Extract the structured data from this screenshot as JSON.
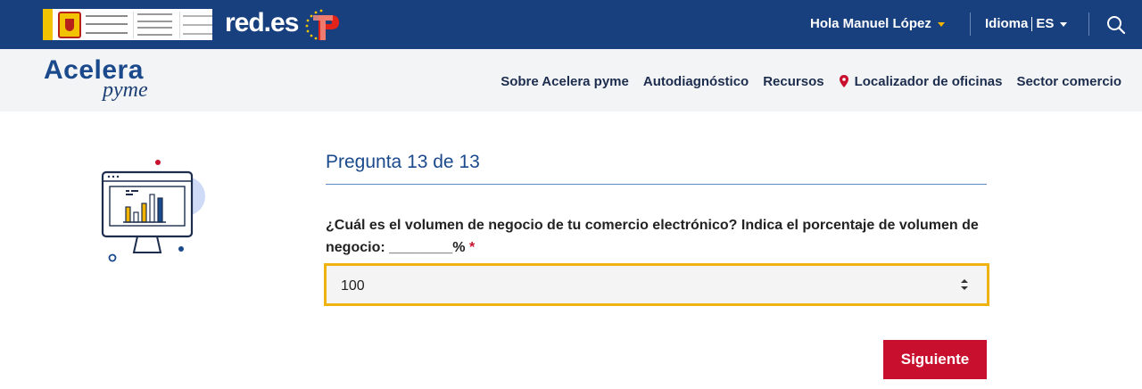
{
  "header": {
    "brand_redes": "red.es",
    "greeting": "Hola Manuel López",
    "language_label": "Idioma",
    "language_value": "ES"
  },
  "nav": {
    "brand_main": "Acelera",
    "brand_sub": "pyme",
    "links": [
      "Sobre Acelera pyme",
      "Autodiagnóstico",
      "Recursos",
      "Localizador de oficinas",
      "Sector comercio"
    ]
  },
  "question": {
    "counter": "Pregunta 13 de 13",
    "text": "¿Cuál es el volumen de negocio de tu comercio electrónico? Indica el porcentaje de volumen de negocio: ________%",
    "required_mark": "*",
    "selected_value": "100"
  },
  "actions": {
    "next_label": "Siguiente"
  },
  "colors": {
    "topbar": "#18407e",
    "brand_blue": "#1b4a8c",
    "accent_red": "#c8102e",
    "focus_gold": "#f0b20f"
  },
  "icons": [
    "spain-government-logo",
    "prtr-logo-icon",
    "search-icon",
    "location-pin-icon",
    "stepper-icon",
    "monitor-chart-illustration"
  ]
}
